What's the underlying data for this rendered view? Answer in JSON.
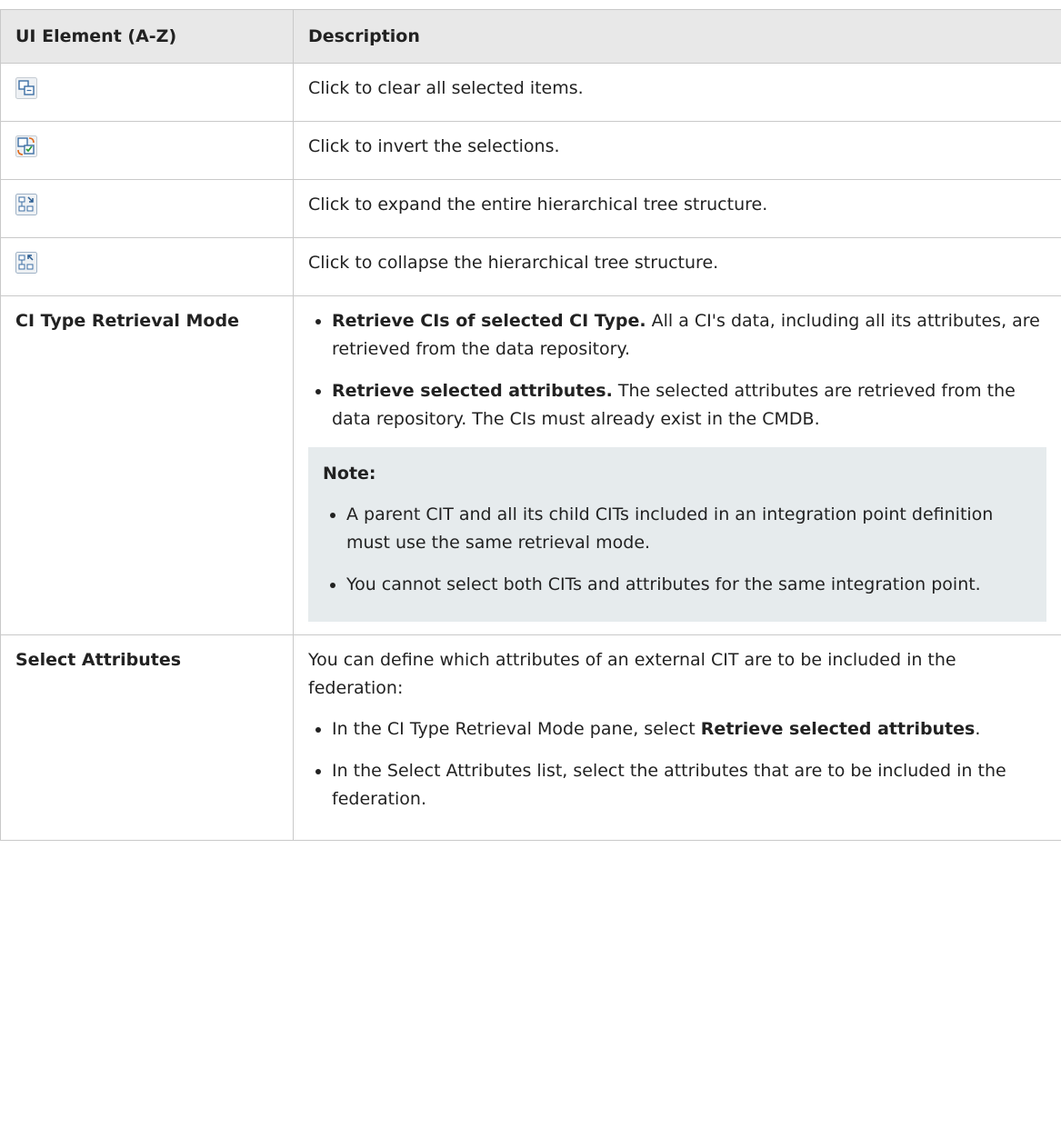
{
  "table": {
    "headers": {
      "col1": "UI Element (A-Z)",
      "col2": "Description"
    },
    "icon_rows": [
      {
        "icon": "clear-selection-icon",
        "description": "Click to clear all selected items."
      },
      {
        "icon": "invert-selection-icon",
        "description": "Click to invert the selections."
      },
      {
        "icon": "expand-tree-icon",
        "description": "Click to expand the entire hierarchical tree structure."
      },
      {
        "icon": "collapse-tree-icon",
        "description": "Click to collapse the hierarchical tree structure."
      }
    ],
    "retrieval_mode": {
      "element": "CI Type Retrieval Mode",
      "bullets": [
        {
          "bold": "Retrieve CIs of selected CI Type.",
          "text": " All a CI's data, including all its attributes, are retrieved from the data repository."
        },
        {
          "bold": "Retrieve selected attributes.",
          "text": " The selected attributes are retrieved from the data repository. The CIs must already exist in the CMDB."
        }
      ],
      "note": {
        "title": "Note:",
        "items": [
          "A parent CIT and all its child CITs included in an integration point definition must use the same retrieval mode.",
          "You cannot select both CITs and attributes for the same integration point."
        ]
      }
    },
    "select_attributes": {
      "element": "Select Attributes",
      "intro": "You can define which attributes of an external CIT are to be included in the federation:",
      "bullet1_pre": "In the CI Type Retrieval Mode pane, select ",
      "bullet1_bold": "Retrieve selected attributes",
      "bullet1_post": ".",
      "bullet2": "In the Select Attributes list, select the attributes that are to be included in the federation."
    }
  }
}
